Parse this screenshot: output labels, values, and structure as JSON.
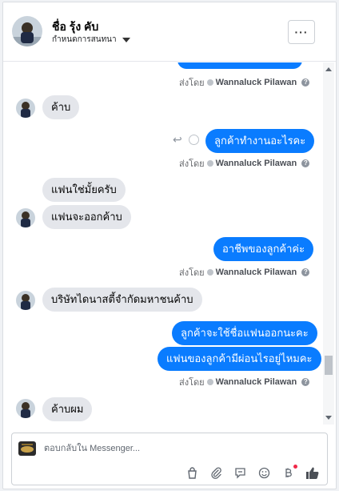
{
  "header": {
    "name": "ชื่อ รุ้ง คับ",
    "subtitle": "กำหนดการสนทนา",
    "more_label": "···"
  },
  "messages": [
    {
      "id": "m0",
      "dir": "out",
      "text": "",
      "sent_by": "ส่งโดย",
      "sender": "Wannaluck Pilawan"
    },
    {
      "id": "m1",
      "dir": "in",
      "text": "ค้าบ"
    },
    {
      "id": "m2",
      "dir": "out",
      "text": "ลูกค้าทำงานอะไรคะ",
      "sent_by": "ส่งโดย",
      "sender": "Wannaluck Pilawan"
    },
    {
      "id": "m3",
      "dir": "in",
      "text": "แฟนใช่มั้ยครับ"
    },
    {
      "id": "m4",
      "dir": "in",
      "text": "แฟนจะออกค้าบ"
    },
    {
      "id": "m5",
      "dir": "out",
      "text": "อาชีพของลูกค้าค่ะ",
      "sent_by": "ส่งโดย",
      "sender": "Wannaluck Pilawan"
    },
    {
      "id": "m6",
      "dir": "in",
      "text": "บริษัทไดนาสตี้จำกัดมหาชนค้าบ"
    },
    {
      "id": "m7",
      "dir": "out",
      "text": "ลูกค้าจะใช้ชื่อแฟนออกนะคะ"
    },
    {
      "id": "m8",
      "dir": "out",
      "text": "แฟนของลูกค้ามีผ่อนไรอยู่ไหมคะ",
      "sent_by": "ส่งโดย",
      "sender": "Wannaluck Pilawan"
    },
    {
      "id": "m9",
      "dir": "in",
      "text": "ค้าบผม"
    }
  ],
  "composer": {
    "placeholder": "ตอบกลับใน Messenger...",
    "tools": [
      "bag-icon",
      "paperclip-icon",
      "reply-template-icon",
      "emoji-icon",
      "currency-icon",
      "like-icon"
    ]
  },
  "colors": {
    "outgoing": "#0a7cff",
    "incoming": "#e4e6eb",
    "like": "#4b4f56"
  }
}
